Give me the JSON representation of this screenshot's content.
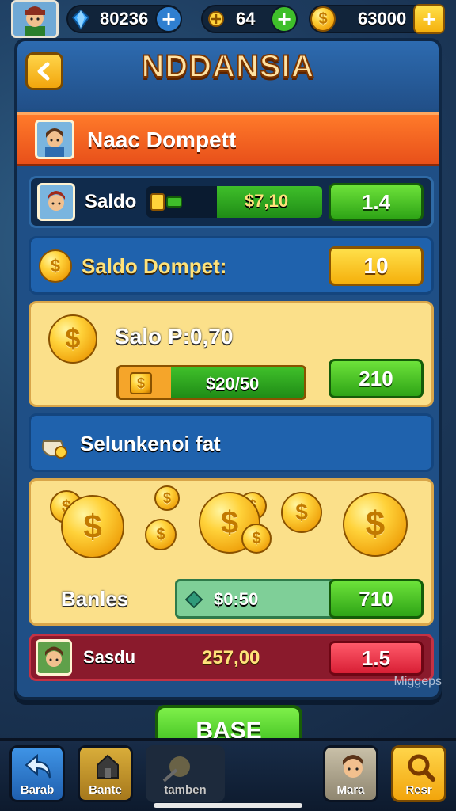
{
  "hud": {
    "gems": "80236",
    "sparkles": "64",
    "coins": "63000"
  },
  "title": "NDDANSIA",
  "wallet_header": {
    "label": "Naac Dompett"
  },
  "saldo": {
    "label": "Saldo",
    "amount": "$7,10",
    "button": "1.4",
    "fill": 0.6
  },
  "saldo_dompet": {
    "label": "Saldo Dompet:",
    "button": "10"
  },
  "saldo_card": {
    "label": "Salo P:0,70",
    "amount": "$20/50",
    "button": "210",
    "fill": 0.6
  },
  "selunken": {
    "label": "Selunkenoi fat"
  },
  "banles": {
    "label": "Banles",
    "amount": "$0:50",
    "button": "710"
  },
  "sasdu": {
    "label": "Sasdu",
    "amount": "257,00",
    "button": "1.5"
  },
  "watermark": "Miggeps",
  "base_button": "BASE",
  "nav": [
    {
      "label": "Barab",
      "color": "#2f7fd0"
    },
    {
      "label": "Bante",
      "color": "#c79a2e"
    },
    {
      "label": "tamben",
      "color": "#3a3a3a"
    },
    {
      "label": "Mara",
      "color": "#3a3a3a"
    },
    {
      "label": "Resr",
      "color": "#f5b50c"
    }
  ]
}
